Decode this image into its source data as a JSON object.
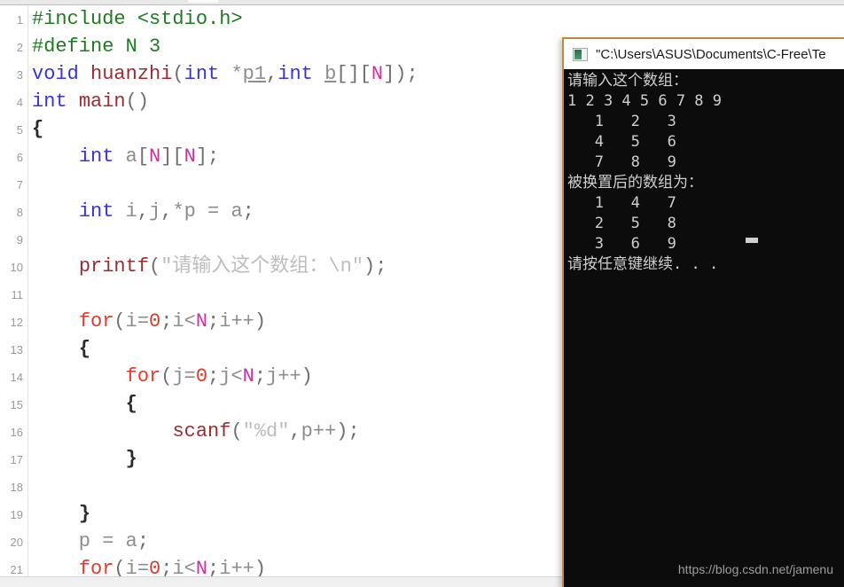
{
  "window": {
    "app": "C-Free IDE",
    "toolbar_visible": true
  },
  "editor": {
    "name": "code-editor",
    "language": "C",
    "lines": [
      {
        "num": "1",
        "text": "#include <stdio.h>"
      },
      {
        "num": "2",
        "text": "#define N 3"
      },
      {
        "num": "3",
        "text": "void huanzhi(int *p1,int b[][N]);"
      },
      {
        "num": "4",
        "text": "int main()"
      },
      {
        "num": "5",
        "text": "{"
      },
      {
        "num": "6",
        "text": "    int a[N][N];"
      },
      {
        "num": "7",
        "text": ""
      },
      {
        "num": "8",
        "text": "    int i,j,*p = a;"
      },
      {
        "num": "9",
        "text": ""
      },
      {
        "num": "10",
        "text": "    printf(\"请输入这个数组：\\n\");"
      },
      {
        "num": "11",
        "text": ""
      },
      {
        "num": "12",
        "text": "    for(i=0;i<N;i++)"
      },
      {
        "num": "13",
        "text": "    {"
      },
      {
        "num": "14",
        "text": "        for(j=0;j<N;j++)"
      },
      {
        "num": "15",
        "text": "        {"
      },
      {
        "num": "16",
        "text": "            scanf(\"%d\",p++);"
      },
      {
        "num": "17",
        "text": "        }"
      },
      {
        "num": "18",
        "text": ""
      },
      {
        "num": "19",
        "text": "    }"
      },
      {
        "num": "20",
        "text": "    p = a;"
      },
      {
        "num": "21",
        "text": "    for(i=0;i<N;i++)"
      }
    ]
  },
  "console": {
    "title": "\"C:\\Users\\ASUS\\Documents\\C-Free\\Te",
    "icon": "console-window-icon",
    "output": [
      "请输入这个数组：",
      "1 2 3 4 5 6 7 8 9",
      "   1   2   3",
      "   4   5   6",
      "   7   8   9",
      "被换置后的数组为：",
      "   1   4   7",
      "   2   5   8",
      "   3   6   9",
      "请按任意键继续. . ."
    ],
    "cursor": "block"
  },
  "watermark": {
    "text": "https://blog.csdn.net/jamenu"
  },
  "colors": {
    "preprocessor": "#1f7a1f",
    "type_keyword": "#3535d8",
    "function_name": "#9b2d30",
    "control_keyword": "#e33a2e",
    "number": "#d93b2b",
    "macro": "#cc2fa8",
    "string": "#bdbdbd",
    "identifier": "#8d8d8d",
    "console_border": "#c08b32",
    "console_background": "#0c0c0c",
    "console_text": "#cfcfcf"
  }
}
